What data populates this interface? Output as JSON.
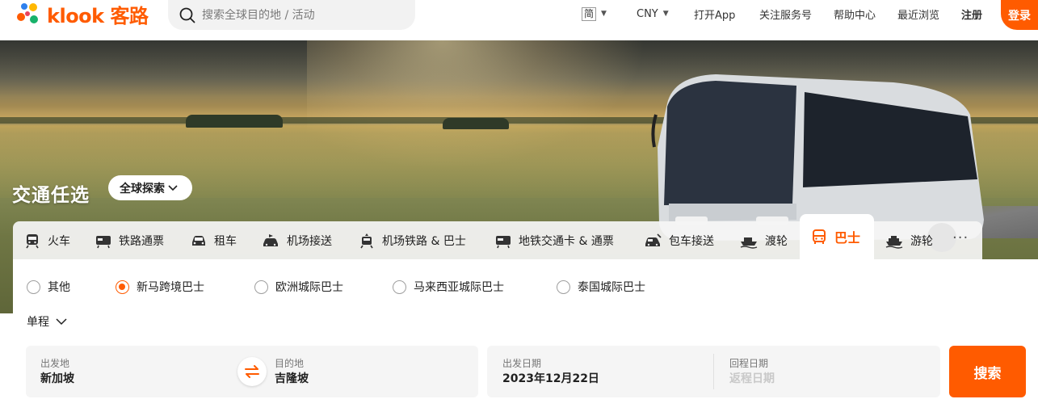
{
  "brand": {
    "name": "klook",
    "name_cn": "客路",
    "accent": "#ff5b00"
  },
  "search": {
    "placeholder": "搜索全球目的地 / 活动"
  },
  "nav": {
    "language": "简",
    "currency": "CNY",
    "open_app": "打开App",
    "follow": "关注服务号",
    "help": "帮助中心",
    "recent": "最近浏览",
    "register": "注册",
    "login": "登录"
  },
  "hero": {
    "title": "交通任选",
    "explore": "全球探索"
  },
  "tabs": [
    {
      "label": "火车",
      "icon": "train-icon"
    },
    {
      "label": "铁路通票",
      "icon": "rail-pass-icon"
    },
    {
      "label": "租车",
      "icon": "car-rental-icon"
    },
    {
      "label": "机场接送",
      "icon": "airport-transfer-icon"
    },
    {
      "label": "机场铁路 & 巴士",
      "icon": "airport-rail-icon"
    },
    {
      "label": "地铁交通卡 & 通票",
      "icon": "metro-card-icon"
    },
    {
      "label": "包车接送",
      "icon": "private-car-icon"
    },
    {
      "label": "渡轮",
      "icon": "ferry-icon"
    },
    {
      "label": "巴士",
      "icon": "bus-icon",
      "active": true
    },
    {
      "label": "游轮",
      "icon": "cruise-icon"
    }
  ],
  "more_label": "···",
  "bus_types": [
    {
      "label": "其他",
      "checked": false
    },
    {
      "label": "新马跨境巴士",
      "checked": true
    },
    {
      "label": "欧洲城际巴士",
      "checked": false
    },
    {
      "label": "马来西亚城际巴士",
      "checked": false
    },
    {
      "label": "泰国城际巴士",
      "checked": false
    }
  ],
  "trip_type": "单程",
  "form": {
    "from_label": "出发地",
    "from_value": "新加坡",
    "to_label": "目的地",
    "to_value": "吉隆坡",
    "depart_label": "出发日期",
    "depart_value": "2023年12月22日",
    "return_label": "回程日期",
    "return_placeholder": "返程日期",
    "search_button": "搜索"
  }
}
